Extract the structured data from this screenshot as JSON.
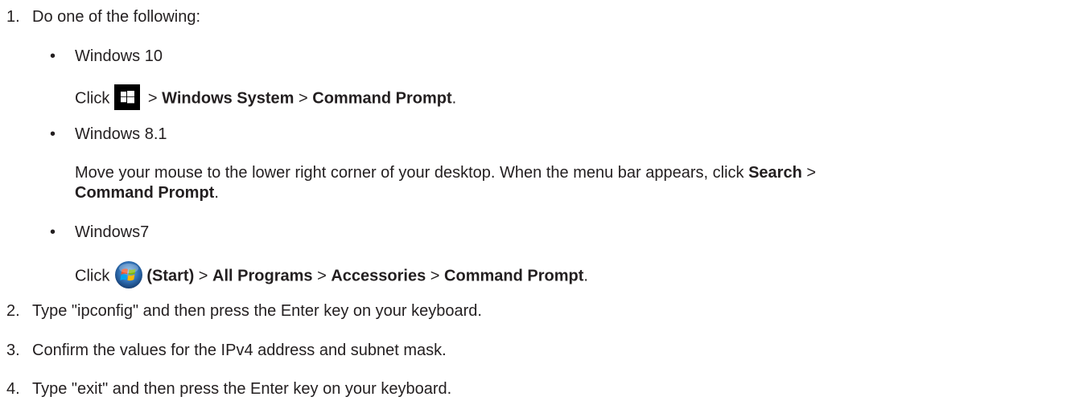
{
  "steps": [
    {
      "number": "1.",
      "text": "Do one of the following:"
    },
    {
      "number": "2.",
      "text": "Type \"ipconfig\" and then press the Enter key on your keyboard."
    },
    {
      "number": "3.",
      "text": "Confirm the values for the IPv4 address and subnet mask."
    },
    {
      "number": "4.",
      "text": "Type \"exit\" and then press the Enter key on your keyboard."
    }
  ],
  "bullet_char": "•",
  "sep": ">",
  "options": {
    "win10": {
      "os": "Windows 10",
      "click": "Click",
      "icon": "windows-logo-icon",
      "path": [
        "Windows System",
        "Command Prompt"
      ],
      "end": "."
    },
    "win81": {
      "os": "Windows 8.1",
      "line1_text": "Move your mouse to the lower right corner of your desktop. When the menu bar appears, click",
      "line1_bold": "Search",
      "line2_bold": "Command Prompt",
      "end": "."
    },
    "win7": {
      "os": "Windows7",
      "click": "Click",
      "icon": "windows7-start-orb-icon",
      "start_label": "(Start)",
      "path": [
        "All Programs",
        "Accessories",
        "Command Prompt"
      ],
      "end": "."
    }
  },
  "colors": {
    "text": "#231f20",
    "win10_icon_bg": "#000000"
  }
}
